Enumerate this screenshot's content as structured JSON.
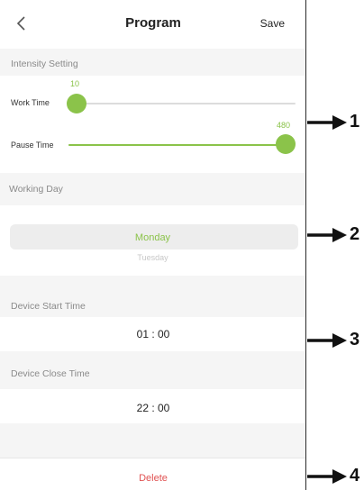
{
  "header": {
    "title": "Program",
    "save_label": "Save",
    "back_icon": "chevron-left-icon"
  },
  "intensity": {
    "section_label": "Intensity Setting",
    "work_time": {
      "label": "Work Time",
      "value": "10",
      "level": 0.0
    },
    "pause_time": {
      "label": "Pause Time",
      "value": "480",
      "level": 1.0
    }
  },
  "working_day": {
    "section_label": "Working Day",
    "selected": "Monday",
    "next": "Tuesday"
  },
  "start_time": {
    "section_label": "Device Start Time",
    "value": "01 : 00"
  },
  "close_time": {
    "section_label": "Device Close Time",
    "value": "22 : 00"
  },
  "footer": {
    "delete_label": "Delete"
  },
  "callouts": [
    "1",
    "2",
    "3",
    "4"
  ],
  "colors": {
    "accent": "#8bc34a",
    "delete": "#e05252",
    "section_bg": "#f5f5f5"
  }
}
